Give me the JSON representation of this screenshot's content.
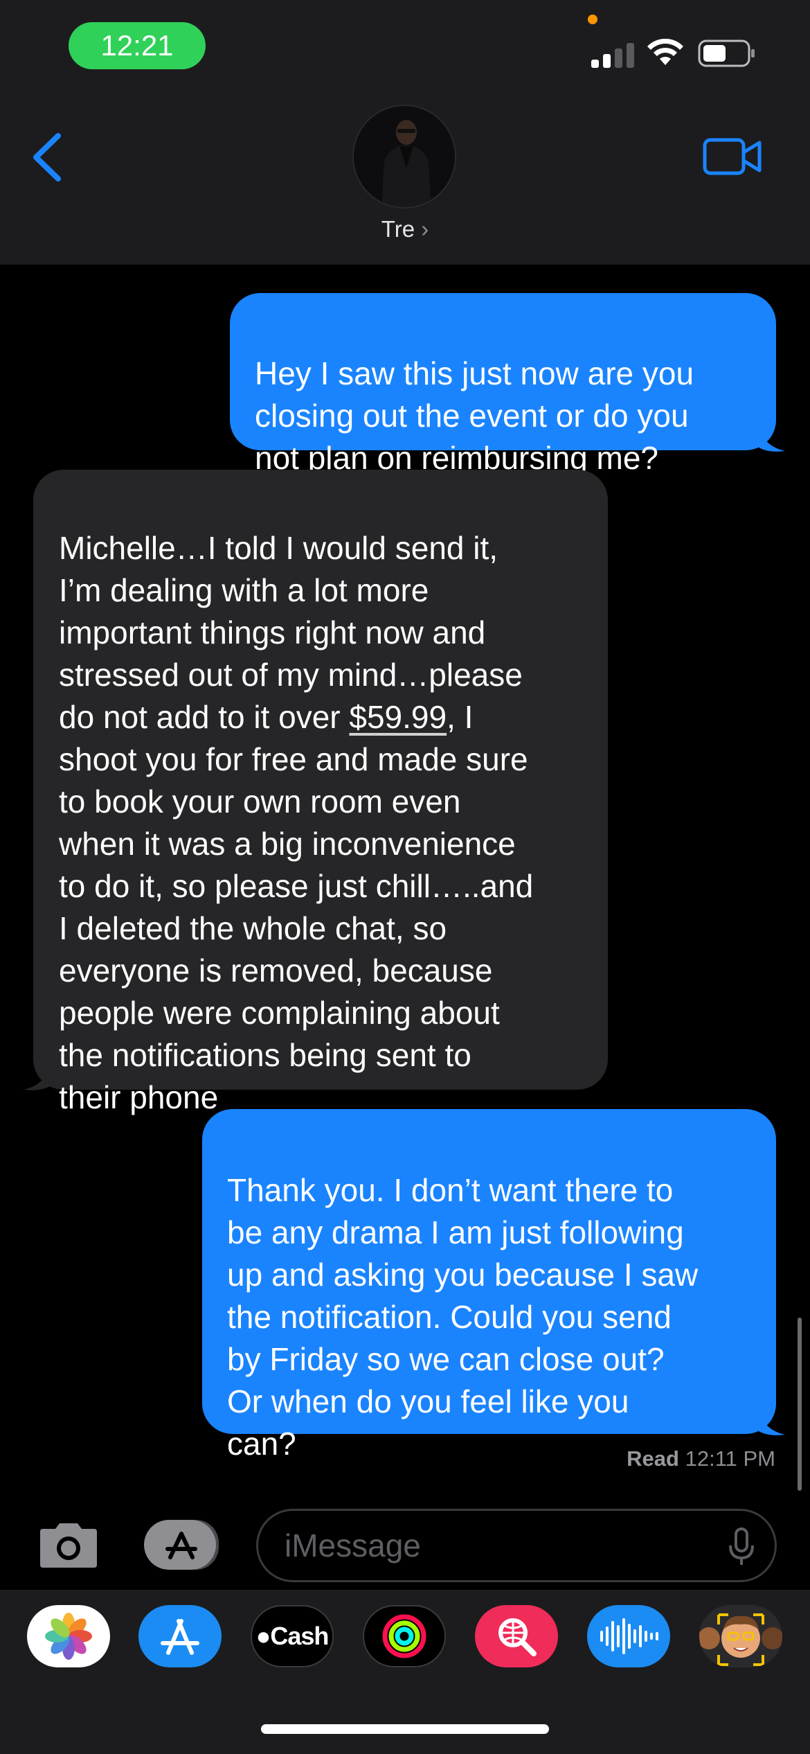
{
  "status_bar": {
    "time": "12:21",
    "time_pill_color": "#30d158",
    "privacy_dot_color": "#ff9500",
    "icons": [
      "cellular-signal-icon",
      "wifi-icon",
      "battery-icon"
    ]
  },
  "header": {
    "back_icon": "chevron-left-icon",
    "contact_name": "Tre",
    "contact_chevron": "›",
    "video_icon": "video-camera-icon",
    "accent_color": "#1a84ff"
  },
  "messages": [
    {
      "direction": "outgoing",
      "text": "Hey I saw this just now are you\nclosing out the event or do you\nnot plan on reimbursing me?"
    },
    {
      "direction": "incoming",
      "text_before_link": "Michelle…I told I would send it,\nI’m dealing with a lot more\nimportant things right now and\nstressed out of my mind…please\ndo not add to it over ",
      "link_text": "$59.99",
      "text_after_link": ", I\nshoot you for free and made sure\nto book your own room even\nwhen it was a big inconvenience\nto do it, so please just chill…..and\nI deleted the whole chat, so\neveryone is removed, because\npeople were complaining about\nthe notifications being sent to\ntheir phone"
    },
    {
      "direction": "outgoing",
      "text": "Thank you. I don’t want there to\nbe any drama I am just following\nup and asking you because I saw\nthe notification. Could you send\nby Friday so we can close out?\nOr when do you feel like you\ncan?"
    }
  ],
  "receipt": {
    "label": "Read",
    "time": "12:11 PM"
  },
  "input_bar": {
    "camera_icon": "camera-icon",
    "apps_icon": "app-store-icon",
    "placeholder": "iMessage",
    "mic_icon": "microphone-icon"
  },
  "app_drawer": {
    "apps": [
      {
        "name": "Photos",
        "icon": "photos-icon"
      },
      {
        "name": "App Store",
        "icon": "app-store-icon"
      },
      {
        "name": "Cash",
        "label": "Cash",
        "icon": "apple-cash-icon"
      },
      {
        "name": "Activity",
        "icon": "activity-rings-icon"
      },
      {
        "name": "Images",
        "icon": "image-search-icon"
      },
      {
        "name": "Audio",
        "icon": "audio-message-icon"
      },
      {
        "name": "Memoji",
        "icon": "memoji-icon"
      }
    ]
  }
}
